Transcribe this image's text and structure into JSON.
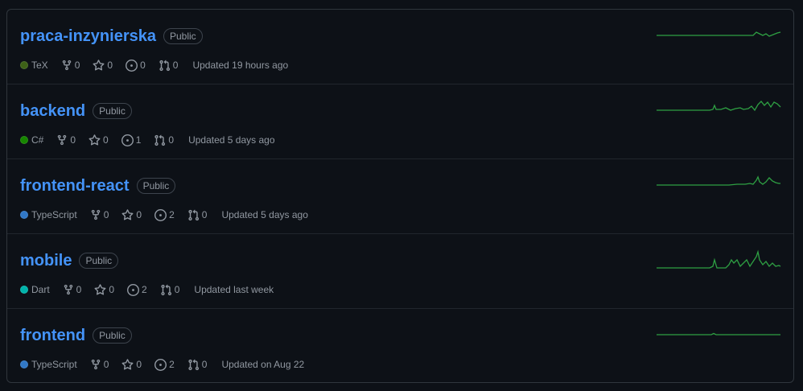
{
  "colors": {
    "link": "#4493f8",
    "muted": "#9198a1",
    "spark": "#2ea043"
  },
  "repos": [
    {
      "name": "praca-inzynierska",
      "visibility": "Public",
      "language": "TeX",
      "language_color": "#3d6117",
      "forks": "0",
      "stars": "0",
      "issues": "0",
      "pulls": "0",
      "updated": "Updated 19 hours ago"
    },
    {
      "name": "backend",
      "visibility": "Public",
      "language": "C#",
      "language_color": "#178600",
      "forks": "0",
      "stars": "0",
      "issues": "1",
      "pulls": "0",
      "updated": "Updated 5 days ago"
    },
    {
      "name": "frontend-react",
      "visibility": "Public",
      "language": "TypeScript",
      "language_color": "#3178c6",
      "forks": "0",
      "stars": "0",
      "issues": "2",
      "pulls": "0",
      "updated": "Updated 5 days ago"
    },
    {
      "name": "mobile",
      "visibility": "Public",
      "language": "Dart",
      "language_color": "#00b4ab",
      "forks": "0",
      "stars": "0",
      "issues": "2",
      "pulls": "0",
      "updated": "Updated last week"
    },
    {
      "name": "frontend",
      "visibility": "Public",
      "language": "TypeScript",
      "language_color": "#3178c6",
      "forks": "0",
      "stars": "0",
      "issues": "2",
      "pulls": "0",
      "updated": "Updated on Aug 22"
    }
  ]
}
